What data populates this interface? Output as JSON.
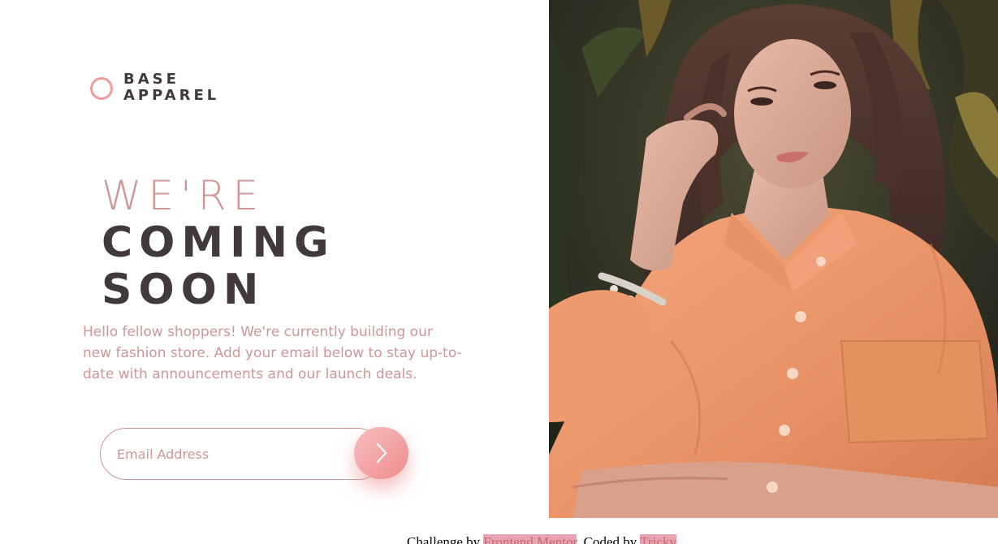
{
  "brand": {
    "line1": "BASE",
    "line2": "APPAREL",
    "accent_color": "#f29b9b",
    "text_color": "#423a3a"
  },
  "headline": {
    "light": "WE'RE",
    "bold_line1": "COMING",
    "bold_line2": "SOON"
  },
  "description": "Hello fellow shoppers! We're currently building our new fashion store. Add your email below to stay up-to-date with announcements and our launch deals.",
  "form": {
    "email_placeholder": "Email Address",
    "submit_icon": "chevron-right-icon"
  },
  "hero": {
    "image": "woman-in-orange-shirt-photo"
  },
  "footer": {
    "challenge_prefix": "Challenge by",
    "challenge_link": "Frontend Mentor",
    "coded_prefix": ". Coded by",
    "coded_link": "Tricky"
  },
  "colors": {
    "desaturated_red": "#ce9797",
    "soft_red": "#f96464",
    "dark_grayish_red": "#423a3a"
  }
}
